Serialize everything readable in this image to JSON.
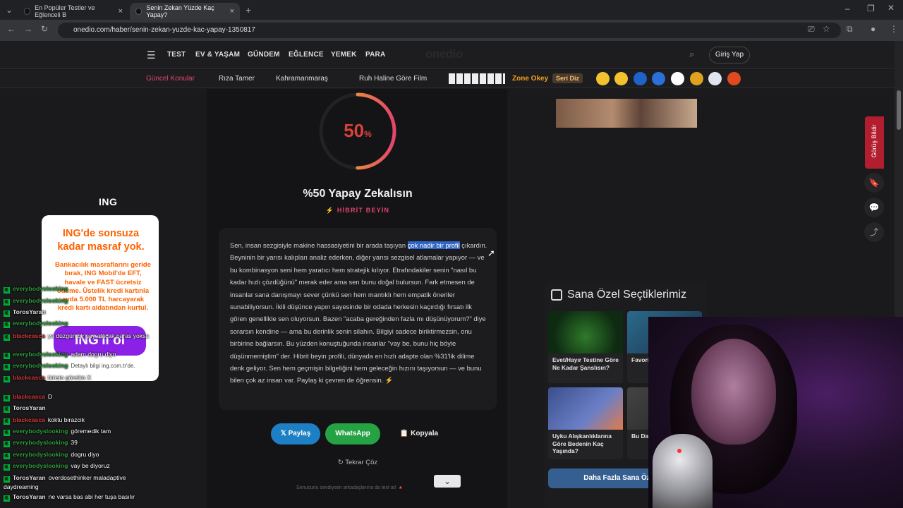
{
  "browser": {
    "tabs": [
      {
        "title": "En Popüler Testler ve Eğlenceli B"
      },
      {
        "title": "Senin Zekan Yüzde Kaç Yapay?"
      }
    ],
    "url": "onedio.com/haber/senin-zekan-yuzde-kac-yapay-1350817"
  },
  "site": {
    "nav": [
      "TEST",
      "EV & YAŞAM",
      "GÜNDEM",
      "EĞLENCE",
      "YEMEK",
      "PARA"
    ],
    "logo": "onedio",
    "login": "Giriş Yap",
    "topics": [
      "Güncel Konular",
      "Rıza Tamer",
      "Kahramanmaraş",
      "Ruh Haline Göre Film",
      "Zone Okey",
      "Seri Diz"
    ]
  },
  "result": {
    "percent": "50",
    "percent_sign": "%",
    "percent_fraction": 0.5,
    "title": "%50 Yapay Zekalısın",
    "subtitle": "⚡ HİBRİT BEYİN",
    "desc_before": "Sen, insan sezgisiyle makine hassasiyetini bir arada taşıyan ",
    "desc_highlight": "çok nadir bir profil",
    "desc_after": " çıkardın. Beyninin bir yarısı kalıpları analiz ederken, diğer yarısı sezgisel atlamalar yapıyor — ve bu kombinasyon seni hem yaratıcı hem stratejik kılıyor. Etrafındakiler senin \"nasıl bu kadar hızlı çözdüğünü\" merak eder ama sen bunu doğal bulursun. Fark etmesen de insanlar sana danışmayı sever çünkü sen hem mantıklı hem empatik öneriler sunabiliyorsun. İkili düşünce yapın sayesinde bir odada herkesin kaçırdığı fırsatı ilk gören genellikle sen oluyorsun. Bazen \"acaba gereğinden fazla mı düşünüyorum?\" diye sorarsın kendine — ama bu derinlik senin silahın. Bilgiyi sadece biriktirmezsin, onu birbirine bağlarsın. Bu yüzden konuştuğunda insanlar \"vay be, bunu hiç böyle düşünmemiştim\" der. Hibrit beyin profili, dünyada en hızlı adapte olan %31'lik dilime denk geliyor. Sen hem geçmişin bilgeliğini hem geleceğin hızını taşıyorsun — ve bunu bilen çok az insan var. Paylaş ki çevren de öğrensin. ⚡",
    "share_x": "𝕏 Paylaş",
    "share_whatsapp": "WhatsApp",
    "copy": "📋 Kopyala",
    "retry": "↻ Tekrar Çöz",
    "footer_note": "Sonucunu sevdiysen arkadaşlarına da test at! 🔺"
  },
  "picks": {
    "title": "Sana Özel Seçtiklerimiz",
    "cards": [
      {
        "caption": "Evet/Hayır Testine Göre Ne Kadar Şanslısın?"
      },
      {
        "caption": "Favori Senin Şehre"
      },
      {
        "caption": "Uyku Alışkanlıklarına Göre Bedenin Kaç Yaşında?"
      },
      {
        "caption": "Bu Dav Yapıyo Bağla"
      }
    ],
    "more": "Daha Fazla Sana Özel İçe"
  },
  "side": {
    "feedback": "Görüş Bildir"
  },
  "ad": {
    "brand": "ING",
    "headline": "ING'de sonsuza kadar masraf yok.",
    "body": "Bankacılık masraflarını geride bırak, ING Mobil'de EFT, havale ve FAST ücretsiz ödeme. Üstelik kredi kartınla ayda 5.000 TL harcayarak kredi kartı aidatından kurtul.",
    "cta": "ING'li ol",
    "foot": "Detaylı bilgi ing.com.tr'de."
  },
  "chat": [
    {
      "user": "everybodyslooking",
      "msg": ""
    },
    {
      "user": "everybodyslooking",
      "msg": ""
    },
    {
      "user": "TorosYaran",
      "msg": ""
    },
    {
      "user": "everybodyslooking",
      "msg": ""
    },
    {
      "user": "blackcasca",
      "msg": "ya düzgün bir şey alacak paras yoksa"
    },
    {
      "user": "everybodyslooking",
      "msg": "adam dogru diyo"
    },
    {
      "user": "everybodyslooking",
      "msg": ""
    },
    {
      "user": "blackcasca",
      "msg": "birisin görelim X"
    },
    {
      "user": "blackcasca",
      "msg": "D"
    },
    {
      "user": "TorosYaran",
      "msg": ""
    },
    {
      "user": "blackcasca",
      "msg": "koktu birazcik"
    },
    {
      "user": "everybodyslooking",
      "msg": "göremedik tam"
    },
    {
      "user": "everybodyslooking",
      "msg": "39"
    },
    {
      "user": "everybodyslooking",
      "msg": "dogru diyo"
    },
    {
      "user": "everybodyslooking",
      "msg": "vay be diyoruz"
    },
    {
      "user": "TorosYaran",
      "msg": "overdosethinker maladaptive daydreaming"
    },
    {
      "user": "TorosYaran",
      "msg": "ne varsa bas abi her tuşa basılır"
    }
  ],
  "colors": {
    "accent": "#e2456d",
    "ring_start": "#f5c518",
    "ring_end": "#e2456d",
    "whatsapp": "#25a244",
    "x_share": "#1d7fc4"
  }
}
